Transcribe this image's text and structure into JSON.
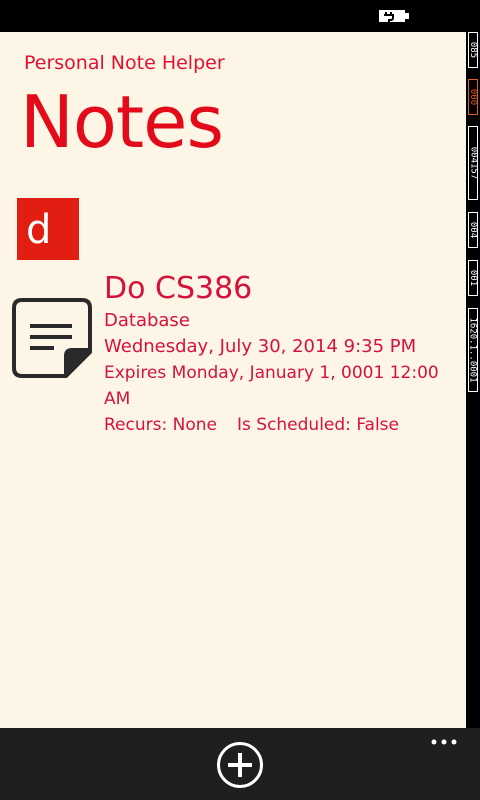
{
  "status_bar": {
    "battery_icon": "battery-charging-icon"
  },
  "side_counters": [
    "085",
    "000",
    "004157",
    "004",
    "001",
    "1620.1..0001"
  ],
  "header": {
    "app_name": "Personal Note Helper",
    "page_title": "Notes"
  },
  "group": {
    "letter": "d"
  },
  "note": {
    "icon": "note-icon",
    "title": "Do CS386",
    "category": "Database",
    "date": "Wednesday, July 30, 2014 9:35 PM",
    "expires": "Expires Monday, January 1, 0001 12:00 AM",
    "recurs": "Recurs: None",
    "scheduled": "Is Scheduled: False"
  },
  "app_bar": {
    "add_icon": "add-icon",
    "more_icon": "more-dots-icon"
  },
  "colors": {
    "accent": "#e30b1a",
    "background": "#fdf5e6",
    "app_bar": "#1f1f1f"
  }
}
